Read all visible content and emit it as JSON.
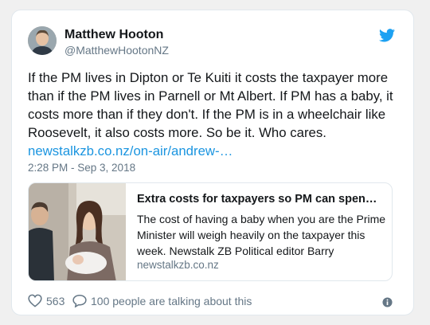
{
  "tweet": {
    "author_name": "Matthew Hooton",
    "author_handle": "@MatthewHootonNZ",
    "text": "If the PM lives in Dipton or Te Kuiti it costs the taxpayer more than if the PM lives in Parnell or Mt Albert. If PM has a baby, it costs more than if they don't. If the PM is in a wheelchair like Roosevelt, it also costs more. So be it. Who cares.",
    "link_text": "newstalkzb.co.nz/on-air/andrew-…",
    "timestamp": "2:28 PM - Sep 3, 2018"
  },
  "link_card": {
    "title": "Extra costs for taxpayers so PM can spen…",
    "description": "The cost of having a baby when you are the Prime Minister will weigh heavily on the taxpayer this week. Newstalk ZB Political editor Barry",
    "domain": "newstalkzb.co.nz"
  },
  "footer": {
    "like_count": "563",
    "talking_text": "100 people are talking about this"
  },
  "icons": {
    "brand": "twitter-bird-icon",
    "like": "heart-icon",
    "reply": "speech-bubble-icon",
    "info": "info-icon"
  },
  "colors": {
    "twitter_blue": "#1da1f2",
    "link": "#1b95e0",
    "muted": "#657786",
    "text": "#14171a",
    "border": "#e1e8ed"
  }
}
